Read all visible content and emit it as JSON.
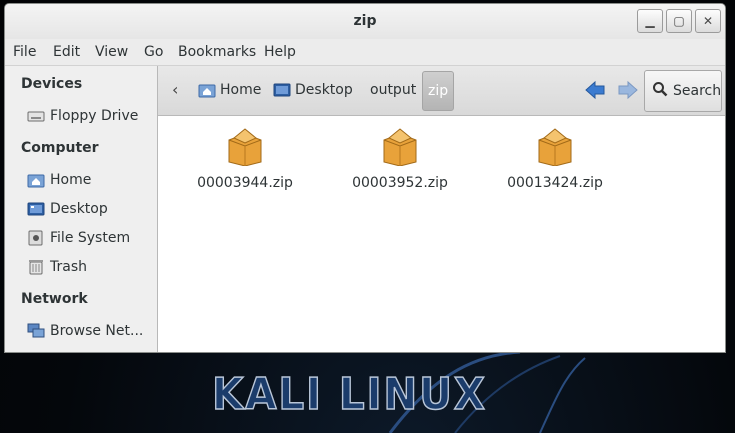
{
  "window": {
    "title": "zip",
    "controls": {
      "minimize": "▁",
      "maximize": "▢",
      "close": "✕"
    }
  },
  "menu": [
    "File",
    "Edit",
    "View",
    "Go",
    "Bookmarks",
    "Help"
  ],
  "sidebar": {
    "sections": [
      {
        "heading": "Devices",
        "items": [
          {
            "label": "Floppy Drive",
            "icon": "floppy-drive-icon"
          }
        ]
      },
      {
        "heading": "Computer",
        "items": [
          {
            "label": "Home",
            "icon": "home-folder-icon"
          },
          {
            "label": "Desktop",
            "icon": "desktop-folder-icon"
          },
          {
            "label": "File System",
            "icon": "file-system-icon"
          },
          {
            "label": "Trash",
            "icon": "trash-icon"
          }
        ]
      },
      {
        "heading": "Network",
        "items": [
          {
            "label": "Browse Net...",
            "icon": "network-icon"
          }
        ]
      }
    ]
  },
  "pathbar": {
    "back_symbol": "‹",
    "crumbs": [
      {
        "label": "Home",
        "icon": "home-folder-icon",
        "active": false
      },
      {
        "label": "Desktop",
        "icon": "desktop-folder-icon",
        "active": false
      },
      {
        "label": "output",
        "icon": "",
        "active": false
      },
      {
        "label": "zip",
        "icon": "",
        "active": true
      }
    ]
  },
  "toolbar": {
    "search_label": "Search"
  },
  "files": [
    {
      "name": "00003944.zip",
      "icon": "zip-archive-icon"
    },
    {
      "name": "00003952.zip",
      "icon": "zip-archive-icon"
    },
    {
      "name": "00013424.zip",
      "icon": "zip-archive-icon"
    }
  ],
  "wallpaper": {
    "logo_text": "KALI LINUX"
  },
  "colors": {
    "window_bg": "#ededed",
    "content_bg": "#ffffff",
    "active_crumb": "#b4b4b4",
    "nav_arrow": "#3b7bd0",
    "package": "#e8a23a",
    "desktop_bg": "#05080c"
  }
}
